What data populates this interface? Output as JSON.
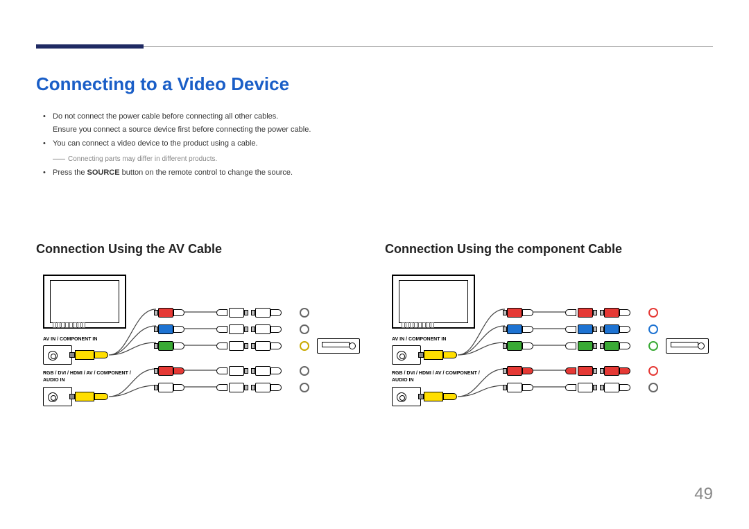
{
  "title": "Connecting to a Video Device",
  "bullets": {
    "b1": "Do not connect the power cable before connecting all other cables.",
    "b1sub": "Ensure you connect a source device first before connecting the power cable.",
    "b2": "You can connect a video device to the product using a cable.",
    "note": "Connecting parts may differ in different products.",
    "b3a": "Press the ",
    "b3bold": "SOURCE",
    "b3b": " button on the remote control to change the source."
  },
  "left": {
    "heading": "Connection Using the AV Cable",
    "port_label_1": "AV IN / COMPONENT IN",
    "port_label_2": "RGB / DVI / HDMI / AV / COMPONENT / AUDIO IN"
  },
  "right": {
    "heading": "Connection Using the component Cable",
    "port_label_1": "AV IN / COMPONENT IN",
    "port_label_2": "RGB / DVI / HDMI / AV / COMPONENT / AUDIO IN"
  },
  "page_number": "49"
}
